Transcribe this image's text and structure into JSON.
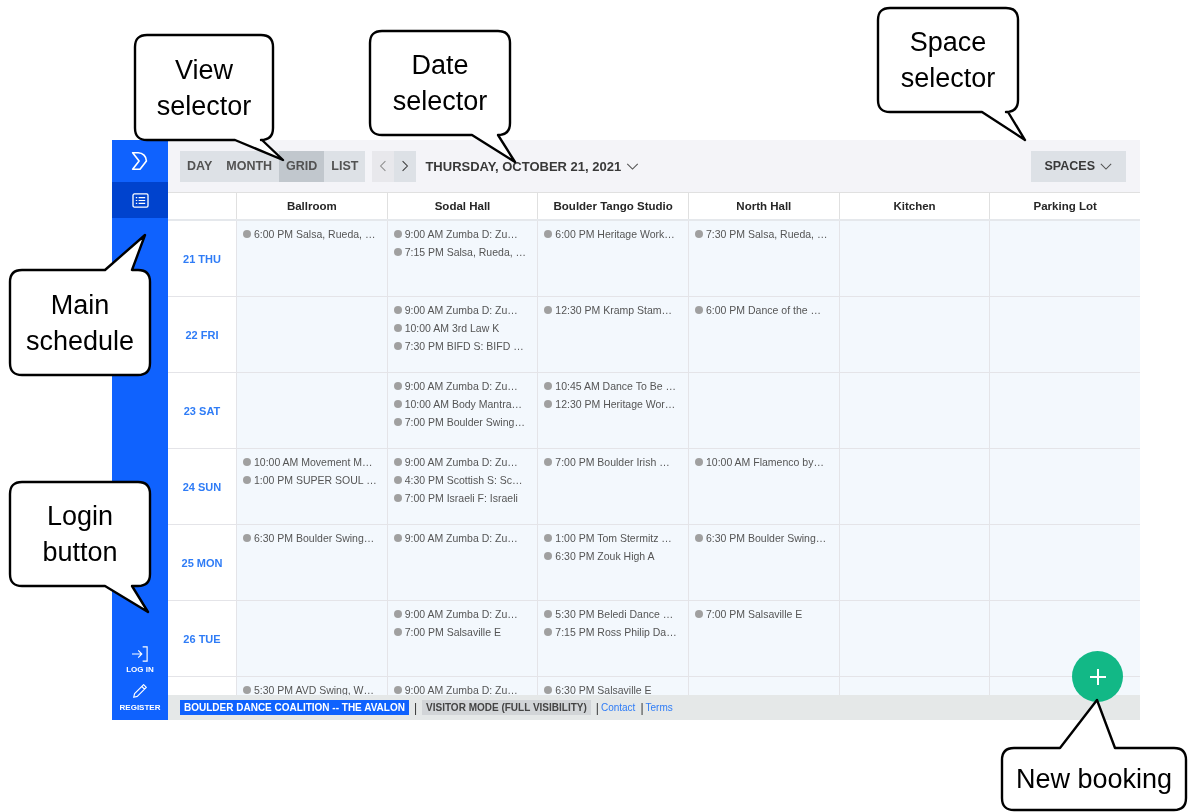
{
  "sidebar": {
    "nav": [
      {
        "kind": "schedule",
        "selected": true
      }
    ],
    "actions": [
      {
        "kind": "login",
        "label": "LOG IN"
      },
      {
        "kind": "register",
        "label": "REGISTER"
      }
    ]
  },
  "toolbar": {
    "views": [
      {
        "label": "DAY",
        "selected": false
      },
      {
        "label": "MONTH",
        "selected": false
      },
      {
        "label": "GRID",
        "selected": true
      },
      {
        "label": "LIST",
        "selected": false
      }
    ],
    "date": "THURSDAY, OCTOBER 21, 2021",
    "spaces_button": "SPACES"
  },
  "schedule": {
    "columns": [
      "Ballroom",
      "Sodal Hall",
      "Boulder Tango Studio",
      "North Hall",
      "Kitchen",
      "Parking Lot"
    ],
    "rows": [
      {
        "date": "21 THU",
        "cells": [
          [
            "6:00 PM Salsa, Rueda, …"
          ],
          [
            "9:00 AM Zumba D: Zu…",
            "7:15 PM Salsa, Rueda, …"
          ],
          [
            "6:00 PM Heritage Work…"
          ],
          [
            "7:30 PM Salsa, Rueda, …"
          ],
          [],
          []
        ]
      },
      {
        "date": "22 FRI",
        "cells": [
          [],
          [
            "9:00 AM Zumba D: Zu…",
            "10:00 AM 3rd Law K",
            "7:30 PM BIFD S: BIFD …"
          ],
          [
            "12:30 PM Kramp Stam…"
          ],
          [
            "6:00 PM Dance of the …"
          ],
          [],
          []
        ]
      },
      {
        "date": "23 SAT",
        "cells": [
          [],
          [
            "9:00 AM Zumba D: Zu…",
            "10:00 AM Body Mantra…",
            "7:00 PM Boulder Swing…"
          ],
          [
            "10:45 AM Dance To Be …",
            "12:30 PM Heritage Wor…"
          ],
          [],
          [],
          []
        ]
      },
      {
        "date": "24 SUN",
        "cells": [
          [
            "10:00 AM Movement M…",
            "1:00 PM SUPER SOUL …"
          ],
          [
            "9:00 AM Zumba D: Zu…",
            "4:30 PM Scottish S: Sc…",
            "7:00 PM Israeli F: Israeli"
          ],
          [
            "7:00 PM Boulder Irish …"
          ],
          [
            "10:00 AM Flamenco by…"
          ],
          [],
          []
        ]
      },
      {
        "date": "25 MON",
        "cells": [
          [
            "6:30 PM Boulder Swing…"
          ],
          [
            "9:00 AM Zumba D: Zu…"
          ],
          [
            "1:00 PM Tom Stermitz …",
            "6:30 PM Zouk High A"
          ],
          [
            "6:30 PM Boulder Swing…"
          ],
          [],
          []
        ]
      },
      {
        "date": "26 TUE",
        "cells": [
          [],
          [
            "9:00 AM Zumba D: Zu…",
            "7:00 PM Salsaville E"
          ],
          [
            "5:30 PM Beledi Dance …",
            "7:15 PM Ross Philip Da…"
          ],
          [
            "7:00 PM Salsaville E"
          ],
          [],
          []
        ]
      },
      {
        "cells": [
          [
            "5:30 PM AVD Swing, W…"
          ],
          [
            "9:00 AM Zumba D: Zu…"
          ],
          [
            "6:30 PM Salsaville E"
          ],
          [],
          [],
          []
        ]
      }
    ]
  },
  "footer": [
    {
      "kind": "org",
      "text": "BOULDER DANCE COALITION -- THE AVALON"
    },
    {
      "kind": "separator",
      "text": "|"
    },
    {
      "kind": "mode",
      "text": "VISITOR MODE (FULL VISIBILITY)"
    },
    {
      "kind": "separator",
      "text": "|"
    },
    {
      "kind": "link",
      "text": "Contact"
    },
    {
      "kind": "separator",
      "text": "|"
    },
    {
      "kind": "link",
      "text": "Terms"
    }
  ],
  "callouts": [
    "View selector",
    "Date selector",
    "Space selector",
    "Main schedule",
    "Login button",
    "New booking"
  ]
}
